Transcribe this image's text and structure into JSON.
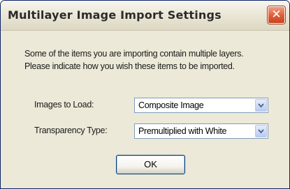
{
  "dialog": {
    "title": "Multilayer Image Import Settings",
    "close_glyph": "✕",
    "message": {
      "line1": "Some of the items you are importing contain multiple layers.",
      "line2": "Please indicate how you wish these items to be imported."
    },
    "fields": {
      "images_to_load": {
        "label": "Images to Load:",
        "value": "Composite Image"
      },
      "transparency_type": {
        "label": "Transparency Type:",
        "value": "Premultiplied with White"
      }
    },
    "ok_label": "OK"
  },
  "icons": {
    "close": "close-icon",
    "dropdown": "chevron-down-icon"
  },
  "colors": {
    "title_bar": "#ece9d8",
    "close_button": "#e0623d",
    "dialog_background": "#ece9d8",
    "input_border": "#7f9db9",
    "default_button_border": "#003c74"
  }
}
